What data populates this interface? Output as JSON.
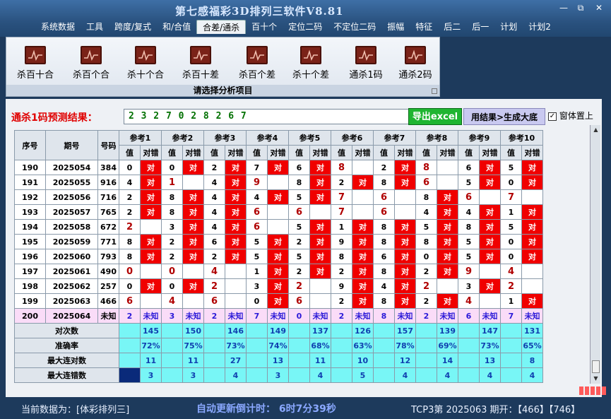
{
  "app": {
    "title": "第七感福彩3D排列三软件V8.81",
    "window_buttons": {
      "minimize": "—",
      "restore": "⧉",
      "close": "✕"
    }
  },
  "menu": [
    "系统数据",
    "工具",
    "跨度/复式",
    "和/合值",
    "合差/通杀",
    "百十个",
    "定位二码",
    "不定位二码",
    "振幅",
    "特征",
    "后二",
    "后一",
    "计划",
    "计划2"
  ],
  "menu_active": "合差/通杀",
  "ribbon": {
    "caption": "请选择分析项目",
    "items": [
      "杀百十合",
      "杀百个合",
      "杀十个合",
      "杀百十差",
      "杀百个差",
      "杀十个差",
      "通杀1码",
      "通杀2码"
    ]
  },
  "prediction": {
    "label": "通杀1码预测结果：",
    "value": "2 3 2 7 0 2 8 2 6 7",
    "excel_button": "导出excel",
    "generate_button": "用结果>生成大底",
    "ontop_label": "窗体置上",
    "ontop_checked": "✓"
  },
  "table": {
    "headers": {
      "seq": "序号",
      "period": "期号",
      "code": "号码",
      "value": "值",
      "result": "对错"
    },
    "refs": [
      "参考1",
      "参考2",
      "参考3",
      "参考4",
      "参考5",
      "参考6",
      "参考7",
      "参考8",
      "参考9",
      "参考10"
    ],
    "rows": [
      {
        "seq": "190",
        "period": "2025054",
        "code": "384",
        "cells": [
          [
            "0",
            "对"
          ],
          [
            "0",
            "对"
          ],
          [
            "2",
            "对"
          ],
          [
            "7",
            "对"
          ],
          [
            "6",
            "对"
          ],
          [
            "8",
            ""
          ],
          [
            "2",
            "对"
          ],
          [
            "8",
            ""
          ],
          [
            "6",
            "对"
          ],
          [
            "5",
            "对"
          ]
        ]
      },
      {
        "seq": "191",
        "period": "2025055",
        "code": "916",
        "cells": [
          [
            "4",
            "对"
          ],
          [
            "1",
            ""
          ],
          [
            "4",
            "对"
          ],
          [
            "9",
            ""
          ],
          [
            "8",
            "对"
          ],
          [
            "2",
            "对"
          ],
          [
            "8",
            "对"
          ],
          [
            "6",
            ""
          ],
          [
            "5",
            "对"
          ],
          [
            "0",
            "对"
          ]
        ]
      },
      {
        "seq": "192",
        "period": "2025056",
        "code": "716",
        "cells": [
          [
            "2",
            "对"
          ],
          [
            "8",
            "对"
          ],
          [
            "4",
            "对"
          ],
          [
            "4",
            "对"
          ],
          [
            "5",
            "对"
          ],
          [
            "7",
            ""
          ],
          [
            "6",
            ""
          ],
          [
            "8",
            "对"
          ],
          [
            "6",
            ""
          ],
          [
            "7",
            ""
          ]
        ]
      },
      {
        "seq": "193",
        "period": "2025057",
        "code": "765",
        "cells": [
          [
            "2",
            "对"
          ],
          [
            "8",
            "对"
          ],
          [
            "4",
            "对"
          ],
          [
            "6",
            ""
          ],
          [
            "6",
            ""
          ],
          [
            "7",
            ""
          ],
          [
            "6",
            ""
          ],
          [
            "4",
            "对"
          ],
          [
            "4",
            "对"
          ],
          [
            "1",
            "对"
          ]
        ]
      },
      {
        "seq": "194",
        "period": "2025058",
        "code": "672",
        "cells": [
          [
            "2",
            ""
          ],
          [
            "3",
            "对"
          ],
          [
            "4",
            "对"
          ],
          [
            "6",
            ""
          ],
          [
            "5",
            "对"
          ],
          [
            "1",
            "对"
          ],
          [
            "8",
            "对"
          ],
          [
            "5",
            "对"
          ],
          [
            "8",
            "对"
          ],
          [
            "5",
            "对"
          ]
        ]
      },
      {
        "seq": "195",
        "period": "2025059",
        "code": "771",
        "cells": [
          [
            "8",
            "对"
          ],
          [
            "2",
            "对"
          ],
          [
            "6",
            "对"
          ],
          [
            "5",
            "对"
          ],
          [
            "2",
            "对"
          ],
          [
            "9",
            "对"
          ],
          [
            "8",
            "对"
          ],
          [
            "8",
            "对"
          ],
          [
            "5",
            "对"
          ],
          [
            "0",
            "对"
          ]
        ]
      },
      {
        "seq": "196",
        "period": "2025060",
        "code": "793",
        "cells": [
          [
            "8",
            "对"
          ],
          [
            "2",
            "对"
          ],
          [
            "2",
            "对"
          ],
          [
            "5",
            "对"
          ],
          [
            "5",
            "对"
          ],
          [
            "8",
            "对"
          ],
          [
            "6",
            "对"
          ],
          [
            "0",
            "对"
          ],
          [
            "5",
            "对"
          ],
          [
            "0",
            "对"
          ]
        ]
      },
      {
        "seq": "197",
        "period": "2025061",
        "code": "490",
        "cells": [
          [
            "0",
            ""
          ],
          [
            "0",
            ""
          ],
          [
            "4",
            ""
          ],
          [
            "1",
            "对"
          ],
          [
            "2",
            "对"
          ],
          [
            "2",
            "对"
          ],
          [
            "8",
            "对"
          ],
          [
            "2",
            "对"
          ],
          [
            "9",
            ""
          ],
          [
            "4",
            ""
          ]
        ]
      },
      {
        "seq": "198",
        "period": "2025062",
        "code": "257",
        "cells": [
          [
            "0",
            "对"
          ],
          [
            "0",
            "对"
          ],
          [
            "2",
            ""
          ],
          [
            "3",
            "对"
          ],
          [
            "2",
            ""
          ],
          [
            "9",
            "对"
          ],
          [
            "4",
            "对"
          ],
          [
            "2",
            ""
          ],
          [
            "3",
            "对"
          ],
          [
            "2",
            ""
          ]
        ]
      },
      {
        "seq": "199",
        "period": "2025063",
        "code": "466",
        "cells": [
          [
            "6",
            ""
          ],
          [
            "4",
            ""
          ],
          [
            "6",
            ""
          ],
          [
            "0",
            "对"
          ],
          [
            "6",
            ""
          ],
          [
            "2",
            "对"
          ],
          [
            "8",
            "对"
          ],
          [
            "2",
            "对"
          ],
          [
            "4",
            ""
          ],
          [
            "1",
            "对"
          ]
        ]
      }
    ],
    "current": {
      "seq": "200",
      "period": "2025064",
      "code": "未知",
      "values": [
        "2",
        "3",
        "2",
        "7",
        "0",
        "2",
        "8",
        "2",
        "6",
        "7"
      ],
      "unknown": "未知"
    },
    "stats": [
      {
        "label": "对次数",
        "values": [
          "145",
          "150",
          "146",
          "149",
          "137",
          "126",
          "157",
          "139",
          "147",
          "131"
        ]
      },
      {
        "label": "准确率",
        "values": [
          "72%",
          "75%",
          "73%",
          "74%",
          "68%",
          "63%",
          "78%",
          "69%",
          "73%",
          "65%"
        ]
      },
      {
        "label": "最大连对数",
        "values": [
          "11",
          "11",
          "27",
          "13",
          "11",
          "10",
          "12",
          "14",
          "13",
          "8"
        ]
      },
      {
        "label": "最大连错数",
        "values": [
          "3",
          "3",
          "4",
          "3",
          "4",
          "5",
          "4",
          "4",
          "4",
          "4"
        ]
      }
    ]
  },
  "status": {
    "current_data": "当前数据为：[体彩排列三]",
    "countdown": "自动更新倒计时： 6时7分39秒",
    "issue_info": "TCP3第 2025063 期开：【466】【746】"
  },
  "colors": {
    "hit_red": "#f00000",
    "miss_text": "#b00000",
    "stat_cyan": "#78f6f6",
    "excel_green": "#1fb531"
  }
}
